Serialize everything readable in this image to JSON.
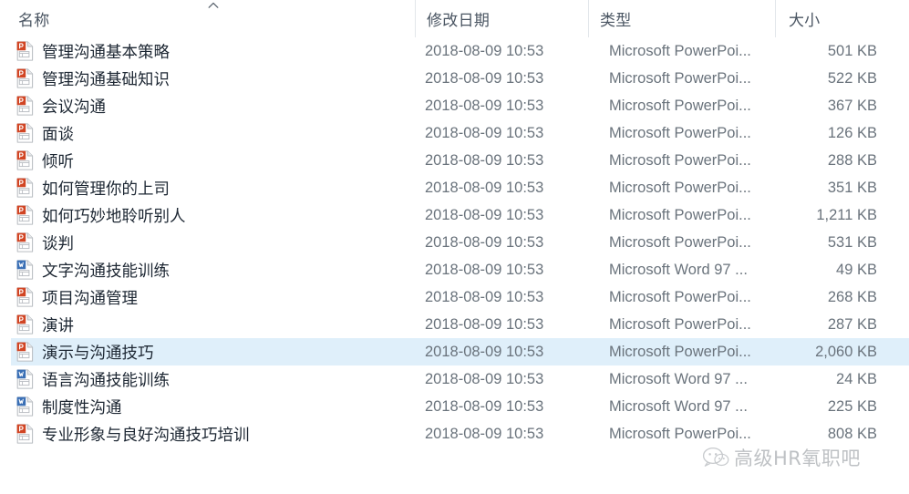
{
  "window": {
    "view": "details-list"
  },
  "columns": {
    "name": "名称",
    "date_modified": "修改日期",
    "type": "类型",
    "size": "大小",
    "sort_column": "名称",
    "sort_direction": "ascending",
    "sort_caret_glyph": "^"
  },
  "colors": {
    "header_text": "#4a5562",
    "row_text": "#1d2733",
    "meta_text": "#6a737c",
    "selection_bg": "#cce5f7",
    "separator": "#e2e6ea",
    "powerpoint_badge": "#d14524",
    "word_badge": "#3a6fb5",
    "page_outline": "#b9bdc2"
  },
  "files": [
    {
      "name": "管理沟通基本策略",
      "date": "2018-08-09 10:53",
      "type": "Microsoft PowerPoi...",
      "size": "501 KB",
      "icon": "powerpoint-file-icon",
      "selected": false
    },
    {
      "name": "管理沟通基础知识",
      "date": "2018-08-09 10:53",
      "type": "Microsoft PowerPoi...",
      "size": "522 KB",
      "icon": "powerpoint-file-icon",
      "selected": false
    },
    {
      "name": "会议沟通",
      "date": "2018-08-09 10:53",
      "type": "Microsoft PowerPoi...",
      "size": "367 KB",
      "icon": "powerpoint-file-icon",
      "selected": false
    },
    {
      "name": "面谈",
      "date": "2018-08-09 10:53",
      "type": "Microsoft PowerPoi...",
      "size": "126 KB",
      "icon": "powerpoint-file-icon",
      "selected": false
    },
    {
      "name": "倾听",
      "date": "2018-08-09 10:53",
      "type": "Microsoft PowerPoi...",
      "size": "288 KB",
      "icon": "powerpoint-file-icon",
      "selected": false
    },
    {
      "name": "如何管理你的上司",
      "date": "2018-08-09 10:53",
      "type": "Microsoft PowerPoi...",
      "size": "351 KB",
      "icon": "powerpoint-file-icon",
      "selected": false
    },
    {
      "name": "如何巧妙地聆听别人",
      "date": "2018-08-09 10:53",
      "type": "Microsoft PowerPoi...",
      "size": "1,211 KB",
      "icon": "powerpoint-file-icon",
      "selected": false
    },
    {
      "name": "谈判",
      "date": "2018-08-09 10:53",
      "type": "Microsoft PowerPoi...",
      "size": "531 KB",
      "icon": "powerpoint-file-icon",
      "selected": false
    },
    {
      "name": "文字沟通技能训练",
      "date": "2018-08-09 10:53",
      "type": "Microsoft Word 97 ...",
      "size": "49 KB",
      "icon": "word-file-icon",
      "selected": false
    },
    {
      "name": "项目沟通管理",
      "date": "2018-08-09 10:53",
      "type": "Microsoft PowerPoi...",
      "size": "268 KB",
      "icon": "powerpoint-file-icon",
      "selected": false
    },
    {
      "name": "演讲",
      "date": "2018-08-09 10:53",
      "type": "Microsoft PowerPoi...",
      "size": "287 KB",
      "icon": "powerpoint-file-icon",
      "selected": false
    },
    {
      "name": "演示与沟通技巧",
      "date": "2018-08-09 10:53",
      "type": "Microsoft PowerPoi...",
      "size": "2,060 KB",
      "icon": "powerpoint-file-icon",
      "selected": true
    },
    {
      "name": "语言沟通技能训练",
      "date": "2018-08-09 10:53",
      "type": "Microsoft Word 97 ...",
      "size": "24 KB",
      "icon": "word-file-icon",
      "selected": false
    },
    {
      "name": "制度性沟通",
      "date": "2018-08-09 10:53",
      "type": "Microsoft Word 97 ...",
      "size": "225 KB",
      "icon": "word-file-icon",
      "selected": false
    },
    {
      "name": "专业形象与良好沟通技巧培训",
      "date": "2018-08-09 10:53",
      "type": "Microsoft PowerPoi...",
      "size": "808 KB",
      "icon": "powerpoint-file-icon",
      "selected": false
    }
  ],
  "watermark": {
    "text": "高级HR氧职吧",
    "icon": "wechat-icon"
  }
}
